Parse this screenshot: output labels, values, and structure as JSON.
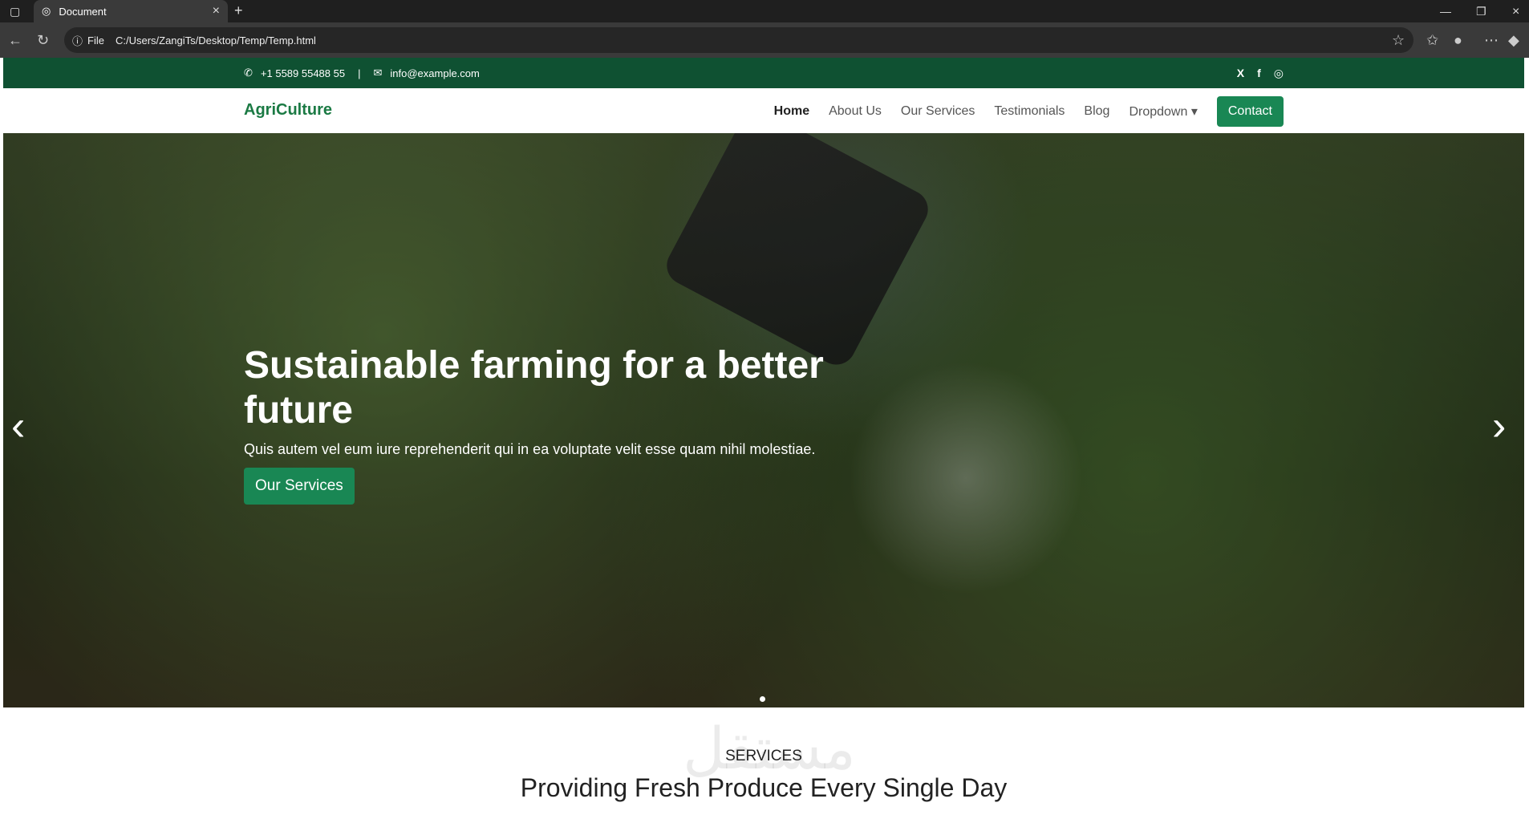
{
  "browser": {
    "tab_title": "Document",
    "url_label": "File",
    "url": "C:/Users/ZangiTs/Desktop/Temp/Temp.html"
  },
  "topbar": {
    "phone": "+1 5589 55488 55",
    "separator": "|",
    "email": "info@example.com",
    "social": [
      "X",
      "f",
      "◎"
    ]
  },
  "navbar": {
    "logo": "AgriCulture",
    "items": [
      {
        "label": "Home",
        "active": true
      },
      {
        "label": "About Us"
      },
      {
        "label": "Our Services"
      },
      {
        "label": "Testimonials"
      },
      {
        "label": "Blog"
      },
      {
        "label": "Dropdown ▾"
      }
    ],
    "contact_button": "Contact"
  },
  "hero": {
    "title": "Sustainable farming for a better future",
    "subtitle": "Quis autem vel eum iure reprehenderit qui in ea voluptate velit esse quam nihil molestiae.",
    "cta": "Our Services"
  },
  "section": {
    "watermark": "مستقل",
    "eyebrow": "SERVICES",
    "heading": "Providing Fresh Produce Every Single Day"
  },
  "colors": {
    "brand_green": "#198754",
    "topbar_green": "#0f5132"
  }
}
